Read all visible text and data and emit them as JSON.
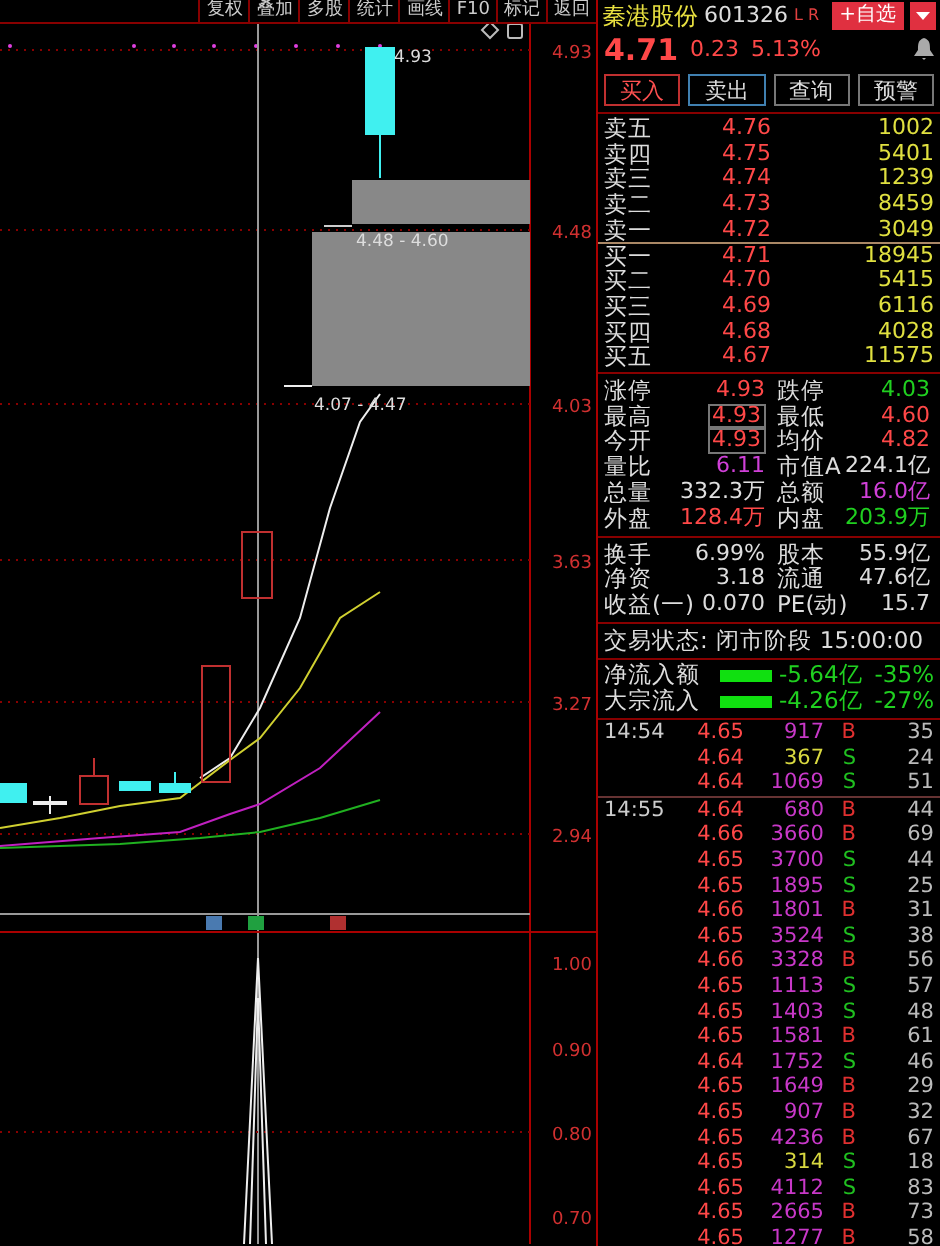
{
  "toolbar": [
    "复权",
    "叠加",
    "多股",
    "统计",
    "画线",
    "F10",
    "标记",
    "返回"
  ],
  "chart": {
    "price_labels": [
      "4.93",
      "4.48",
      "4.03",
      "3.63",
      "3.27",
      "2.94"
    ],
    "annotations": [
      "4.93",
      "4.48 - 4.60",
      "4.07 - 4.47"
    ],
    "indicator_labels": [
      "1.00",
      "0.90",
      "0.80",
      "0.70"
    ]
  },
  "quote": {
    "name": "秦港股份",
    "code": "601326",
    "flags": "L R",
    "watch_button": "+自选",
    "price": "4.71",
    "change": "0.23",
    "change_pct": "5.13%"
  },
  "actions": [
    {
      "label": "买入",
      "kind": "buy"
    },
    {
      "label": "卖出",
      "kind": "sell"
    },
    {
      "label": "查询",
      "kind": "plain"
    },
    {
      "label": "预警",
      "kind": "plain"
    }
  ],
  "order_book": {
    "asks": [
      {
        "label": "卖五",
        "price": "4.76",
        "volume": "1002"
      },
      {
        "label": "卖四",
        "price": "4.75",
        "volume": "5401"
      },
      {
        "label": "卖三",
        "price": "4.74",
        "volume": "1239"
      },
      {
        "label": "卖二",
        "price": "4.73",
        "volume": "8459"
      },
      {
        "label": "卖一",
        "price": "4.72",
        "volume": "3049"
      }
    ],
    "bids": [
      {
        "label": "买一",
        "price": "4.71",
        "volume": "18945"
      },
      {
        "label": "买二",
        "price": "4.70",
        "volume": "5415"
      },
      {
        "label": "买三",
        "price": "4.69",
        "volume": "6116"
      },
      {
        "label": "买四",
        "price": "4.68",
        "volume": "4028"
      },
      {
        "label": "买五",
        "price": "4.67",
        "volume": "11575"
      }
    ]
  },
  "stats": [
    {
      "label": "涨停",
      "value": "4.93",
      "color": "#ff4848",
      "boxed": false
    },
    {
      "label": "跌停",
      "value": "4.03",
      "color": "#20d020",
      "boxed": false
    },
    {
      "label": "最高",
      "value": "4.93",
      "color": "#ff4848",
      "boxed": true
    },
    {
      "label": "最低",
      "value": "4.60",
      "color": "#ff4848",
      "boxed": false
    },
    {
      "label": "今开",
      "value": "4.93",
      "color": "#ff4848",
      "boxed": true
    },
    {
      "label": "均价",
      "value": "4.82",
      "color": "#ff4848",
      "boxed": false
    },
    {
      "label": "量比",
      "value": "6.11",
      "color": "#d040d8",
      "boxed": false
    },
    {
      "label": "市值A",
      "value": "224.1亿",
      "color": "#e0e0e0",
      "boxed": false
    },
    {
      "label": "总量",
      "value": "332.3万",
      "color": "#e0e0e0",
      "boxed": false
    },
    {
      "label": "总额",
      "value": "16.0亿",
      "color": "#d040d8",
      "boxed": false
    },
    {
      "label": "外盘",
      "value": "128.4万",
      "color": "#ff4848",
      "boxed": false
    },
    {
      "label": "内盘",
      "value": "203.9万",
      "color": "#20d020",
      "boxed": false
    }
  ],
  "fundamentals": [
    {
      "label": "换手",
      "value": "6.99%"
    },
    {
      "label": "股本",
      "value": "55.9亿"
    },
    {
      "label": "净资",
      "value": "3.18"
    },
    {
      "label": "流通",
      "value": "47.6亿"
    },
    {
      "label": "收益(一)",
      "value": "0.070"
    },
    {
      "label": "PE(动)",
      "value": "15.7"
    }
  ],
  "trade_status": {
    "label": "交易状态:",
    "value": "闭市阶段",
    "time": "15:00:00"
  },
  "flows": [
    {
      "label": "净流入额",
      "amount": "-5.64亿",
      "pct": "-35%"
    },
    {
      "label": "大宗流入",
      "amount": "-4.26亿",
      "pct": "-27%"
    }
  ],
  "ticks": [
    {
      "time": "14:54",
      "trades": [
        {
          "price": "4.65",
          "volume": "917",
          "color": "#c838c8",
          "side": "B",
          "kind": "buy",
          "count": "35"
        },
        {
          "price": "4.64",
          "volume": "367",
          "color": "#d8d840",
          "side": "S",
          "kind": "sell",
          "count": "24"
        },
        {
          "price": "4.64",
          "volume": "1069",
          "color": "#c838c8",
          "side": "S",
          "kind": "sell",
          "count": "51"
        }
      ]
    },
    {
      "time": "14:55",
      "trades": [
        {
          "price": "4.64",
          "volume": "680",
          "color": "#c838c8",
          "side": "B",
          "kind": "buy",
          "count": "44"
        },
        {
          "price": "4.66",
          "volume": "3660",
          "color": "#c838c8",
          "side": "B",
          "kind": "buy",
          "count": "69"
        },
        {
          "price": "4.65",
          "volume": "3700",
          "color": "#c838c8",
          "side": "S",
          "kind": "sell",
          "count": "44"
        },
        {
          "price": "4.65",
          "volume": "1895",
          "color": "#c838c8",
          "side": "S",
          "kind": "sell",
          "count": "25"
        },
        {
          "price": "4.66",
          "volume": "1801",
          "color": "#c838c8",
          "side": "B",
          "kind": "buy",
          "count": "31"
        },
        {
          "price": "4.65",
          "volume": "3524",
          "color": "#c838c8",
          "side": "S",
          "kind": "sell",
          "count": "38"
        },
        {
          "price": "4.66",
          "volume": "3328",
          "color": "#c838c8",
          "side": "B",
          "kind": "buy",
          "count": "56"
        },
        {
          "price": "4.65",
          "volume": "1113",
          "color": "#c838c8",
          "side": "S",
          "kind": "sell",
          "count": "57"
        },
        {
          "price": "4.65",
          "volume": "1403",
          "color": "#c838c8",
          "side": "S",
          "kind": "sell",
          "count": "48"
        },
        {
          "price": "4.65",
          "volume": "1581",
          "color": "#c838c8",
          "side": "B",
          "kind": "buy",
          "count": "61"
        },
        {
          "price": "4.64",
          "volume": "1752",
          "color": "#c838c8",
          "side": "S",
          "kind": "sell",
          "count": "46"
        },
        {
          "price": "4.65",
          "volume": "1649",
          "color": "#c838c8",
          "side": "B",
          "kind": "buy",
          "count": "29"
        },
        {
          "price": "4.65",
          "volume": "907",
          "color": "#c838c8",
          "side": "B",
          "kind": "buy",
          "count": "32"
        },
        {
          "price": "4.65",
          "volume": "4236",
          "color": "#c838c8",
          "side": "B",
          "kind": "buy",
          "count": "67"
        },
        {
          "price": "4.65",
          "volume": "314",
          "color": "#d8d840",
          "side": "S",
          "kind": "sell",
          "count": "18"
        },
        {
          "price": "4.65",
          "volume": "4112",
          "color": "#c838c8",
          "side": "S",
          "kind": "sell",
          "count": "83"
        },
        {
          "price": "4.65",
          "volume": "2665",
          "color": "#c838c8",
          "side": "B",
          "kind": "buy",
          "count": "73"
        },
        {
          "price": "4.65",
          "volume": "1277",
          "color": "#c838c8",
          "side": "B",
          "kind": "buy",
          "count": "58"
        }
      ]
    }
  ]
}
